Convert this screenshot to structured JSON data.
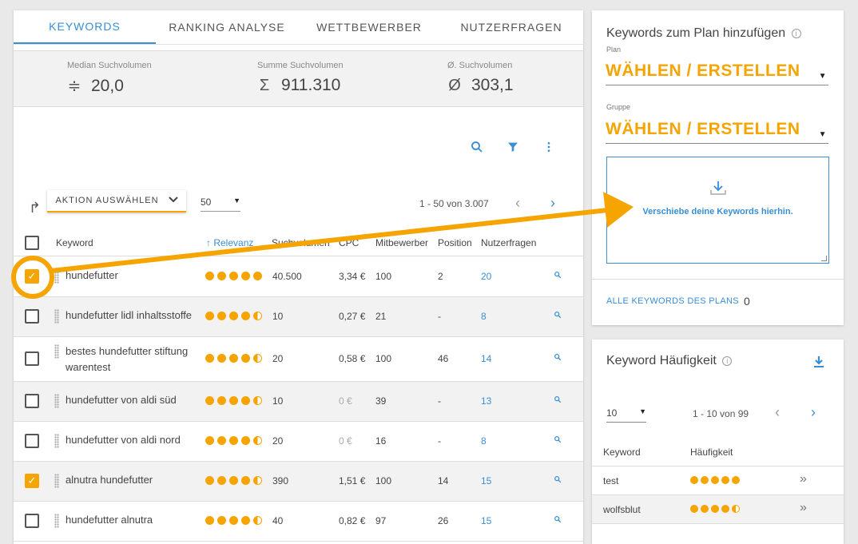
{
  "tabs": [
    "KEYWORDS",
    "RANKING ANALYSE",
    "WETTBEWERBER",
    "NUTZERFRAGEN"
  ],
  "stats": [
    {
      "label": "Median Suchvolumen",
      "symbol": "≑",
      "value": "20,0"
    },
    {
      "label": "Summe Suchvolumen",
      "symbol": "Σ",
      "value": "911.310"
    },
    {
      "label": "Ø. Suchvolumen",
      "symbol": "Ø",
      "value": "303,1"
    }
  ],
  "toolbar": {
    "action_label": "AKTION AUSWÄHLEN",
    "per_page": "50",
    "pagination": "1 - 50 von 3.007"
  },
  "columns": {
    "keyword": "Keyword",
    "relevanz": "↑ Relevanz",
    "suchvolumen": "Suchvolumen",
    "cpc": "CPC",
    "mitbewerber": "Mitbewerber",
    "position": "Position",
    "nutzerfragen": "Nutzerfragen"
  },
  "rows": [
    {
      "keyword": "hundefutter",
      "relevanz": 5,
      "suchvolumen": "40.500",
      "cpc": "3,34 €",
      "mitbewerber": "100",
      "position": "2",
      "nutzerfragen": "20",
      "checked": true
    },
    {
      "keyword": "hundefutter lidl inhaltsstoffe",
      "relevanz": 4.5,
      "suchvolumen": "10",
      "cpc": "0,27 €",
      "mitbewerber": "21",
      "position": "-",
      "nutzerfragen": "8",
      "checked": false
    },
    {
      "keyword": "bestes hundefutter stiftung warentest",
      "relevanz": 4.5,
      "suchvolumen": "20",
      "cpc": "0,58 €",
      "mitbewerber": "100",
      "position": "46",
      "nutzerfragen": "14",
      "checked": false
    },
    {
      "keyword": "hundefutter von aldi süd",
      "relevanz": 4.5,
      "suchvolumen": "10",
      "cpc": "0 €",
      "mitbewerber": "39",
      "position": "-",
      "nutzerfragen": "13",
      "checked": false
    },
    {
      "keyword": "hundefutter von aldi nord",
      "relevanz": 4.5,
      "suchvolumen": "20",
      "cpc": "0 €",
      "mitbewerber": "16",
      "position": "-",
      "nutzerfragen": "8",
      "checked": false
    },
    {
      "keyword": "alnutra hundefutter",
      "relevanz": 4.5,
      "suchvolumen": "390",
      "cpc": "1,51 €",
      "mitbewerber": "100",
      "position": "14",
      "nutzerfragen": "15",
      "checked": true
    },
    {
      "keyword": "hundefutter alnutra",
      "relevanz": 4.5,
      "suchvolumen": "40",
      "cpc": "0,82 €",
      "mitbewerber": "97",
      "position": "26",
      "nutzerfragen": "15",
      "checked": false
    }
  ],
  "plan": {
    "title": "Keywords zum Plan hinzufügen",
    "plan_label": "Plan",
    "plan_value": "WÄHLEN / ERSTELLEN",
    "group_label": "Gruppe",
    "group_value": "WÄHLEN / ERSTELLEN",
    "dropzone_text": "Verschiebe deine Keywords hierhin.",
    "all_keywords_label": "ALLE KEYWORDS DES PLANS",
    "all_keywords_count": "0"
  },
  "frequency": {
    "title": "Keyword Häufigkeit",
    "per_page": "10",
    "pagination": "1 - 10 von 99",
    "col_keyword": "Keyword",
    "col_freq": "Häufigkeit",
    "rows": [
      {
        "keyword": "test",
        "freq": 5
      },
      {
        "keyword": "wolfsblut",
        "freq": 4.5
      }
    ]
  },
  "colors": {
    "accent": "#3a8ed4",
    "highlight": "#f5a400"
  },
  "icons": [
    "search-icon",
    "filter-icon",
    "more-vert-icon",
    "redirect-icon",
    "chevron-down-icon",
    "chevron-left-icon",
    "chevron-right-icon",
    "drag-handle-icon",
    "download-icon",
    "info-icon",
    "double-chevron-icon",
    "arrow-annotation"
  ]
}
